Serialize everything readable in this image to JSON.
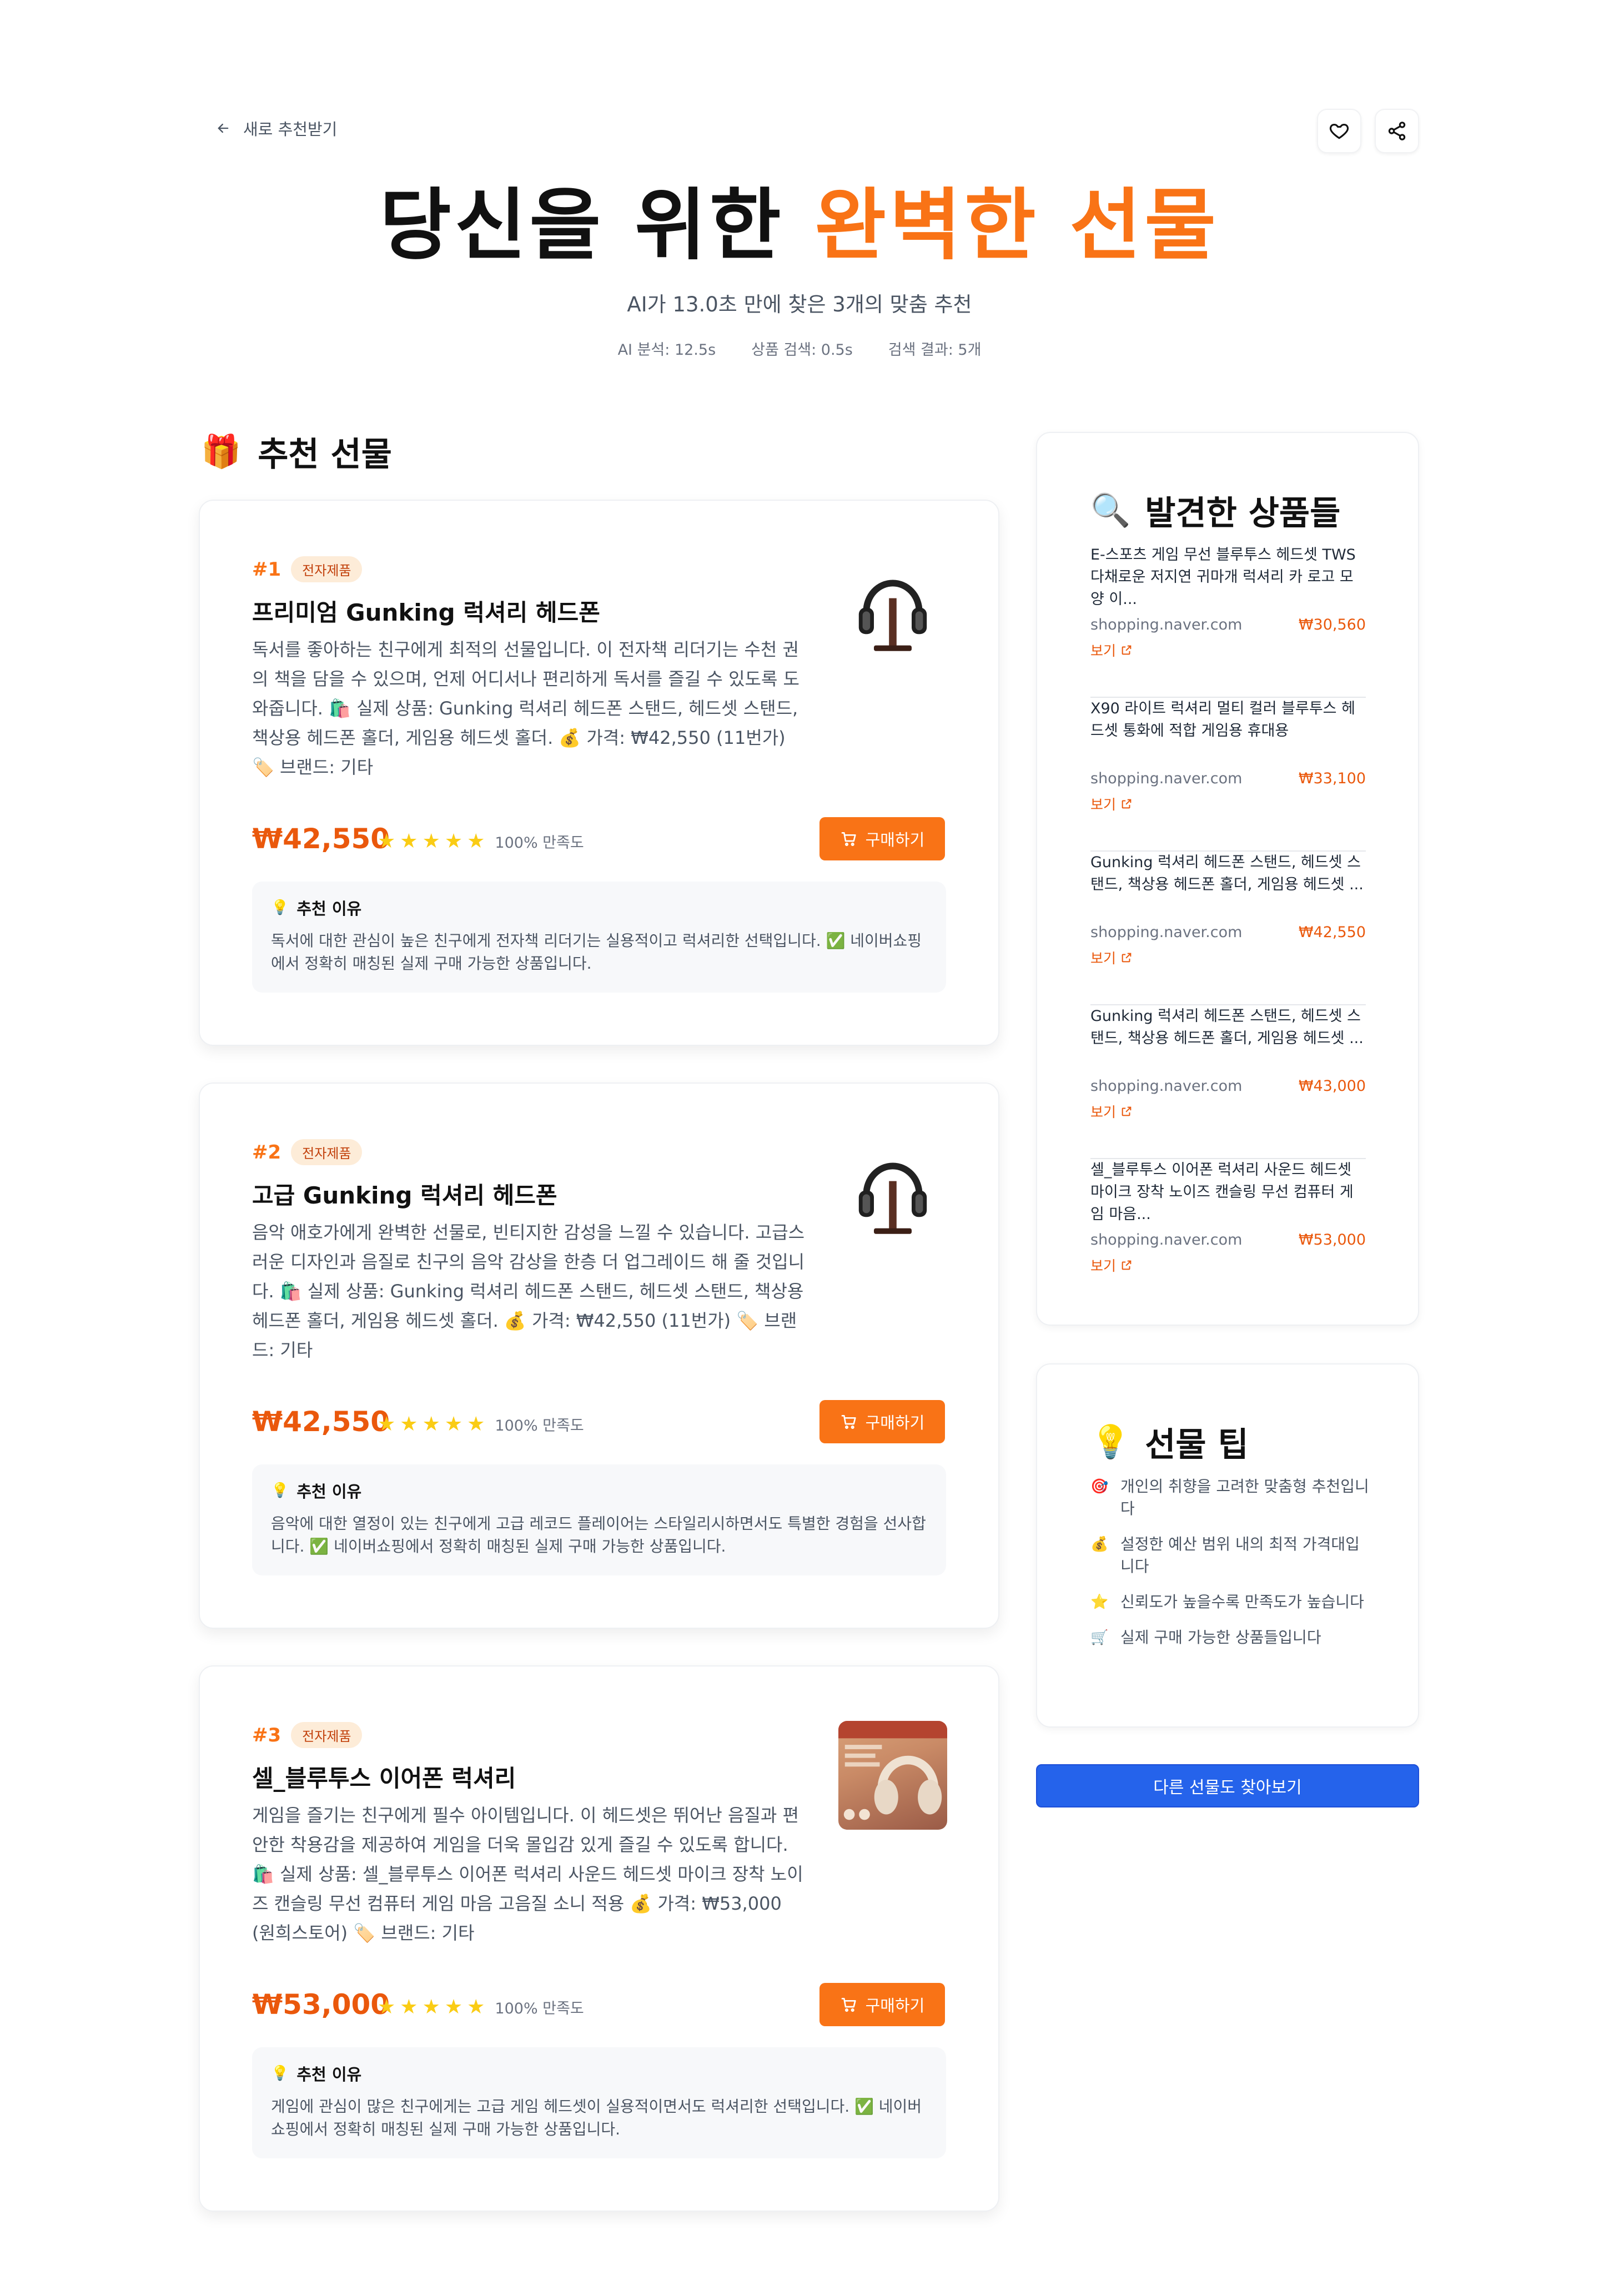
{
  "nav": {
    "back_label": "새로 추천받기"
  },
  "hero": {
    "title_main": "당신을 위한 ",
    "title_accent": "완벽한 선물",
    "subtitle": "AI가 13.0초 만에 찾은 3개의 맞춤 추천",
    "stats": [
      "AI 분석: 12.5s",
      "상품 검색: 0.5s",
      "검색 결과: 5개"
    ]
  },
  "recommend": {
    "heading_icon": "🎁",
    "heading": "추천 선물",
    "buy_label": "구매하기",
    "reason_title": "추천 이유",
    "satisfaction": "100% 만족도",
    "items": [
      {
        "rank": "#1",
        "category": "전자제품",
        "name": "프리미엄 Gunking 럭셔리 헤드폰",
        "description": "독서를 좋아하는 친구에게 최적의 선물입니다. 이 전자책 리더기는 수천 권의 책을 담을 수 있으며, 언제 어디서나 편리하게 독서를 즐길 수 있도록 도와줍니다. 🛍️ 실제 상품: Gunking 럭셔리 헤드폰 스탠드, 헤드셋 스탠드, 책상용 헤드폰 홀더, 게임용 헤드셋 홀더. 💰 가격: ₩42,550 (11번가) 🏷️ 브랜드: 기타",
        "price": "₩42,550",
        "rating": 5,
        "reason": "독서에 대한 관심이 높은 친구에게 전자책 리더기는 실용적이고 럭셔리한 선택입니다. ✅ 네이버쇼핑에서 정확히 매칭된 실제 구매 가능한 상품입니다.",
        "image_icon": "headphone-stand-image"
      },
      {
        "rank": "#2",
        "category": "전자제품",
        "name": "고급 Gunking 럭셔리 헤드폰",
        "description": "음악 애호가에게 완벽한 선물로, 빈티지한 감성을 느낄 수 있습니다. 고급스러운 디자인과 음질로 친구의 음악 감상을 한층 더 업그레이드 해 줄 것입니다. 🛍️ 실제 상품: Gunking 럭셔리 헤드폰 스탠드, 헤드셋 스탠드, 책상용 헤드폰 홀더, 게임용 헤드셋 홀더. 💰 가격: ₩42,550 (11번가) 🏷️ 브랜드: 기타",
        "price": "₩42,550",
        "rating": 5,
        "reason": "음악에 대한 열정이 있는 친구에게 고급 레코드 플레이어는 스타일리시하면서도 특별한 경험을 선사합니다. ✅ 네이버쇼핑에서 정확히 매칭된 실제 구매 가능한 상품입니다.",
        "image_icon": "headphone-stand-image"
      },
      {
        "rank": "#3",
        "category": "전자제품",
        "name": "셀_블루투스 이어폰 럭셔리",
        "description": "게임을 즐기는 친구에게 필수 아이템입니다. 이 헤드셋은 뛰어난 음질과 편안한 착용감을 제공하여 게임을 더욱 몰입감 있게 즐길 수 있도록 합니다. 🛍️ 실제 상품: 셀_블루투스 이어폰 럭셔리 사운드 헤드셋 마이크 장착 노이즈 캔슬링 무선 컴퓨터 게임 마음 고음질 소니 적용 💰 가격: ₩53,000 (원희스토어) 🏷️ 브랜드: 기타",
        "price": "₩53,000",
        "rating": 5,
        "reason": "게임에 관심이 많은 친구에게는 고급 게임 헤드셋이 실용적이면서도 럭셔리한 선택입니다. ✅ 네이버쇼핑에서 정확히 매칭된 실제 구매 가능한 상품입니다.",
        "image_icon": "wireless-headphones-image"
      }
    ]
  },
  "found": {
    "heading_icon": "🔍",
    "heading": "발견한 상품들",
    "link_label": "보기",
    "items": [
      {
        "title": "E-스포츠 게임 무선 블루투스 헤드셋 TWS 다채로운 저지연 귀마개 럭셔리 카 로고 모양 이...",
        "source": "shopping.naver.com",
        "price": "₩30,560"
      },
      {
        "title": "X90 라이트 럭셔리 멀티 컬러 블루투스 헤드셋 통화에 적합 게임용 휴대용",
        "source": "shopping.naver.com",
        "price": "₩33,100"
      },
      {
        "title": "Gunking 럭셔리 헤드폰 스탠드, 헤드셋 스탠드, 책상용 헤드폰 홀더, 게임용 헤드셋 ...",
        "source": "shopping.naver.com",
        "price": "₩42,550"
      },
      {
        "title": "Gunking 럭셔리 헤드폰 스탠드, 헤드셋 스탠드, 책상용 헤드폰 홀더, 게임용 헤드셋 ...",
        "source": "shopping.naver.com",
        "price": "₩43,000"
      },
      {
        "title": "셀_블루투스 이어폰 럭셔리 사운드 헤드셋 마이크 장착 노이즈 캔슬링 무선 컴퓨터 게임 마음...",
        "source": "shopping.naver.com",
        "price": "₩53,000"
      }
    ]
  },
  "tips": {
    "heading_icon": "💡",
    "heading": "선물 팁",
    "items": [
      {
        "icon": "🎯",
        "text": "개인의 취향을 고려한 맞춤형 추천입니다"
      },
      {
        "icon": "💰",
        "text": "설정한 예산 범위 내의 최적 가격대입니다"
      },
      {
        "icon": "⭐",
        "text": "신뢰도가 높을수록 만족도가 높습니다"
      },
      {
        "icon": "🛒",
        "text": "실제 구매 가능한 상품들입니다"
      }
    ]
  },
  "more_button": "다른 선물도 찾아보기",
  "colors": {
    "accent": "#f97316",
    "price": "#ea580c",
    "primary_button": "#2563eb"
  }
}
